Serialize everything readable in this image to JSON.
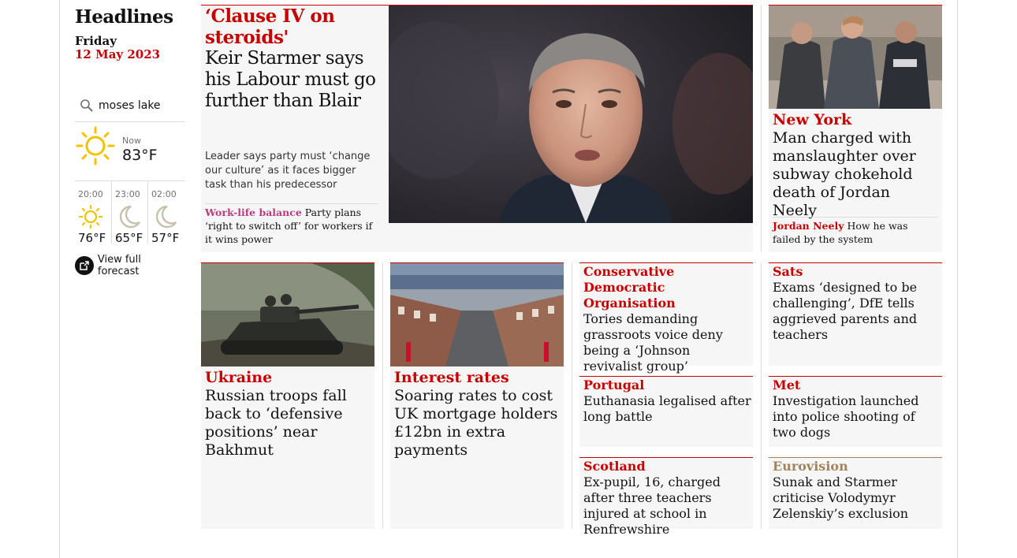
{
  "sidebar": {
    "title": "Headlines",
    "day": "Friday",
    "date": "12 May 2023",
    "search_location": "moses lake",
    "weather_now": {
      "label": "Now",
      "temp": "83°F",
      "icon": "sun-icon"
    },
    "forecast": [
      {
        "time": "20:00",
        "temp": "76°F",
        "icon": "sun-icon"
      },
      {
        "time": "23:00",
        "temp": "65°F",
        "icon": "moon-icon"
      },
      {
        "time": "02:00",
        "temp": "57°F",
        "icon": "moon-icon"
      }
    ],
    "full_forecast_label": "View full forecast"
  },
  "main_story": {
    "kicker": "‘Clause IV on steroids'",
    "headline": "Keir Starmer says his Labour must go further than Blair",
    "standfirst": "Leader says party must ‘change our culture’ as it faces bigger task than his predecessor",
    "sublink": {
      "kicker": "Work-life balance",
      "text": "Party plans ‘right to switch off’ for workers if it wins power"
    }
  },
  "ny_story": {
    "kicker": "New York",
    "headline": "Man charged with manslaughter over subway chokehold death of Jordan Neely",
    "sublink": {
      "kicker": "Jordan Neely",
      "text": "How he was failed by the system"
    }
  },
  "row2": [
    {
      "kicker": "Ukraine",
      "headline": "Russian troops fall back to ‘defensive positions’ near Bakhmut"
    },
    {
      "kicker": "Interest rates",
      "headline": "Soaring rates to cost UK mortgage holders £12bn in extra payments"
    }
  ],
  "small_cards": [
    {
      "kicker": "Conservative Democratic Organisation",
      "headline": "Tories demanding grassroots voice deny being a ‘Johnson revivalist group’"
    },
    {
      "kicker": "Sats",
      "headline": "Exams ‘designed to be challenging’, DfE tells aggrieved parents and teachers"
    },
    {
      "kicker": "Portugal",
      "headline": "Euthanasia legalised after long battle"
    },
    {
      "kicker": "Met",
      "headline": "Investigation launched into police shooting of two dogs"
    },
    {
      "kicker": "Scotland",
      "headline": "Ex-pupil, 16, charged after three teachers injured at school in Renfrewshire"
    },
    {
      "kicker": "Eurovision",
      "headline": "Sunak and Starmer criticise Volodymyr Zelenskiy’s exclusion"
    }
  ],
  "colors": {
    "news_red": "#c70000",
    "lifestyle_pink": "#bb3b80",
    "culture_gold": "#a1845c",
    "card_bg": "#f6f6f6"
  }
}
